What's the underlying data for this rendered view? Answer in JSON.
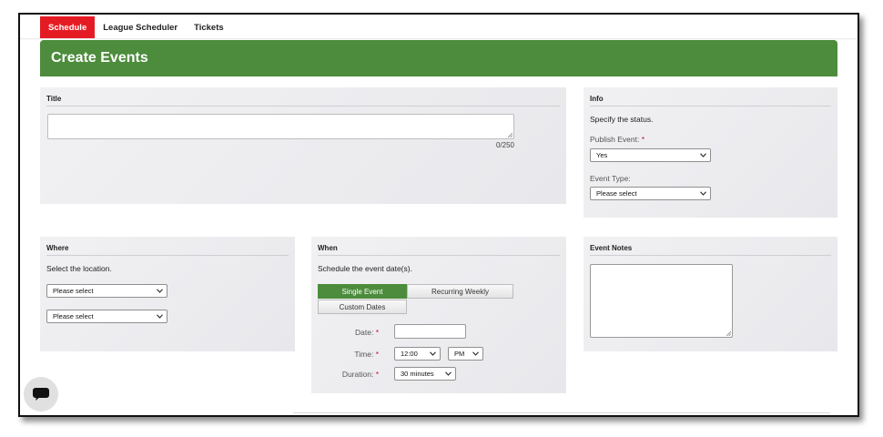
{
  "nav": {
    "items": [
      {
        "label": "Schedule",
        "active": true
      },
      {
        "label": "League Scheduler",
        "active": false
      },
      {
        "label": "Tickets",
        "active": false
      }
    ]
  },
  "page": {
    "title": "Create Events"
  },
  "title_panel": {
    "heading": "Title",
    "value": "",
    "counter": "0/250"
  },
  "info_panel": {
    "heading": "Info",
    "description": "Specify the status.",
    "publish_label": "Publish Event:",
    "publish_value": "Yes",
    "event_type_label": "Event Type:",
    "event_type_value": "Please select"
  },
  "where_panel": {
    "heading": "Where",
    "description": "Select the location.",
    "select1": "Please select",
    "select2": "Please select"
  },
  "when_panel": {
    "heading": "When",
    "description": "Schedule the event date(s).",
    "tabs": {
      "single": "Single Event",
      "recurring": "Recurring Weekly",
      "custom": "Custom Dates"
    },
    "date_label": "Date:",
    "date_value": "",
    "time_label": "Time:",
    "time_value": "12:00",
    "ampm_value": "PM",
    "duration_label": "Duration:",
    "duration_value": "30 minutes"
  },
  "notes_panel": {
    "heading": "Event Notes",
    "value": ""
  },
  "colors": {
    "brand_green": "#4c8c3c",
    "nav_red": "#e51b24",
    "required": "#c8102e"
  },
  "icons": {
    "chat": "chat-bubble-icon",
    "dropdown": "chevron-down-icon",
    "resize": "resize-grip-icon"
  }
}
